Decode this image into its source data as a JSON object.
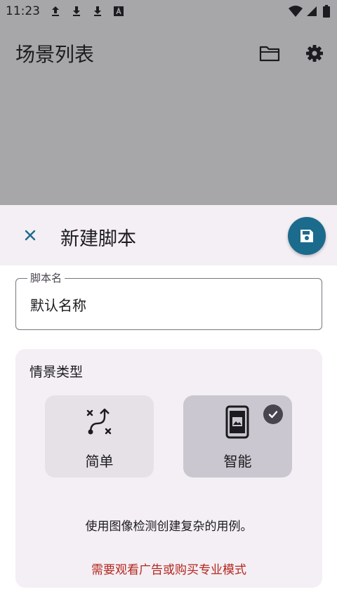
{
  "status_bar": {
    "time": "11:23",
    "left_icons": [
      "upload-icon",
      "download-icon",
      "download-icon",
      "font-notification-icon"
    ],
    "right_icons": [
      "wifi-icon",
      "signal-icon",
      "battery-icon"
    ]
  },
  "app_bar": {
    "title": "场景列表",
    "actions": [
      "folder-icon",
      "settings-icon"
    ]
  },
  "sheet": {
    "title": "新建脚本",
    "close_icon": "close-icon",
    "save_icon": "save-icon",
    "name_field": {
      "label": "脚本名",
      "value": "默认名称"
    },
    "scenario_type": {
      "heading": "情景类型",
      "options": [
        {
          "label": "简单",
          "icon": "route-icon",
          "selected": false
        },
        {
          "label": "智能",
          "icon": "phone-image-icon",
          "selected": true
        }
      ],
      "description": "使用图像检测创建复杂的用例。",
      "upgrade_text": "需要观看广告或购买专业模式"
    }
  },
  "colors": {
    "scrim": "#a7a7a9",
    "accent": "#1b6b8c",
    "warning_text": "#b3261e",
    "selected_option": "#cac7d0"
  }
}
